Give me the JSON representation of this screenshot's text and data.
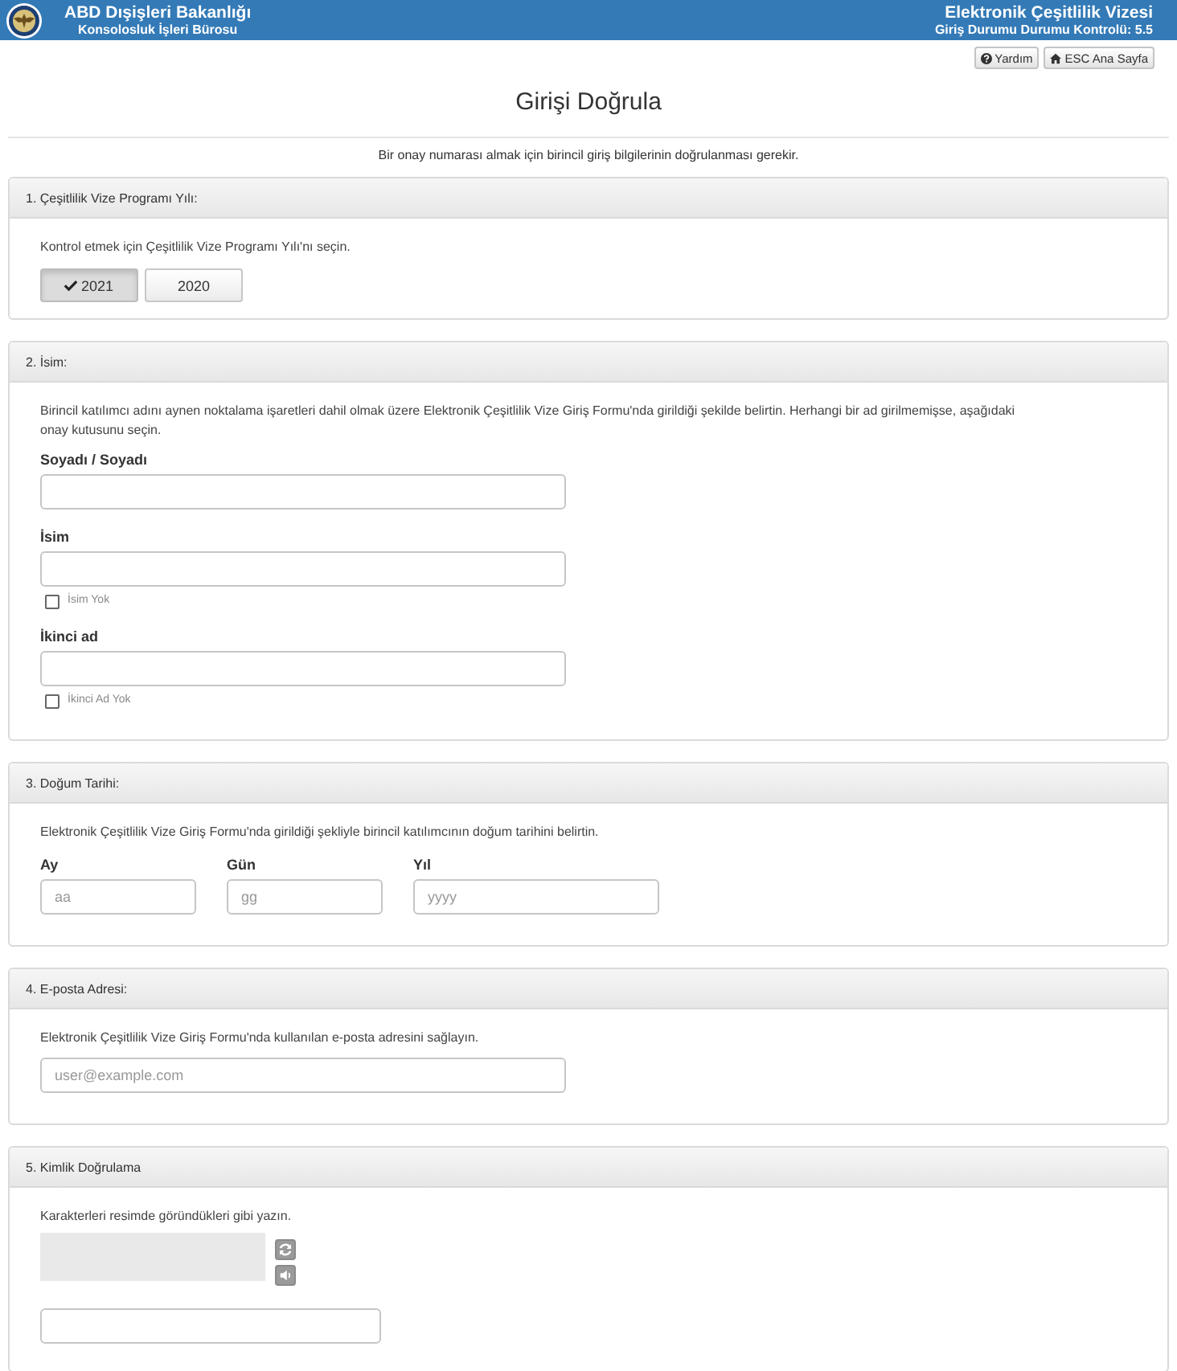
{
  "header": {
    "agency": "ABD Dışişleri Bakanlığı",
    "bureau": "Konsolosluk İşleri Bürosu",
    "app_title": "Elektronik Çeşitlilik Vizesi",
    "app_subtitle": "Giriş Durumu Durumu Kontrolü: 5.5"
  },
  "toolbar": [
    {
      "kind": "help",
      "label": "Yardım"
    },
    {
      "kind": "home",
      "label": "ESC Ana Sayfa"
    }
  ],
  "page_title": "Girişi Doğrula",
  "intro": "Bir onay numarası almak için birincil giriş bilgilerinin doğrulanması gerekir.",
  "sections": [
    {
      "title": "1. Çeşitlilik Vize Programı Yılı:",
      "kind": "stacked",
      "instructions": "Kontrol etmek için Çeşitlilik Vize Programı Yılı'nı seçin.",
      "fields": [
        {
          "kind": "choice",
          "options": [
            {
              "label": "2021",
              "selected": true
            },
            {
              "label": "2020",
              "selected": false
            }
          ]
        }
      ]
    },
    {
      "title": "2. İsim:",
      "kind": "stacked",
      "instructions": "Birincil katılımcı adını aynen noktalama işaretleri dahil olmak üzere Elektronik Çeşitlilik Vize Giriş Formu'nda girildiği şekilde belirtin. Herhangi bir ad girilmemişse, aşağıdaki onay kutusunu seçin.",
      "fields": [
        {
          "kind": "text",
          "label": "Soyadı / Soyadı"
        },
        {
          "kind": "text",
          "label": "İsim",
          "checkbox": {
            "label": "İsim Yok",
            "checked": false
          }
        },
        {
          "kind": "text",
          "label": "İkinci ad",
          "checkbox": {
            "label": "İkinci Ad Yok",
            "checked": false
          }
        }
      ]
    },
    {
      "title": "3. Doğum Tarihi:",
      "kind": "inline",
      "instructions": "Elektronik Çeşitlilik Vize Giriş Formu'nda girildiği şekliyle birincil katılımcının doğum tarihini belirtin.",
      "fields": [
        {
          "kind": "text",
          "label": "Ay",
          "placeholder": "aa"
        },
        {
          "kind": "text",
          "label": "Gün",
          "placeholder": "gg"
        },
        {
          "kind": "text",
          "label": "Yıl",
          "placeholder": "yyyy"
        }
      ]
    },
    {
      "title": "4. E-posta Adresi:",
      "kind": "stacked",
      "instructions": "Elektronik Çeşitlilik Vize Giriş Formu'nda kullanılan e-posta adresini sağlayın.",
      "fields": [
        {
          "kind": "text",
          "placeholder": "user@example.com"
        }
      ]
    },
    {
      "title": "5. Kimlik Doğrulama",
      "kind": "stacked",
      "instructions": "Karakterleri resimde göründükleri gibi yazın.",
      "fields": [
        {
          "kind": "captcha"
        }
      ]
    }
  ]
}
